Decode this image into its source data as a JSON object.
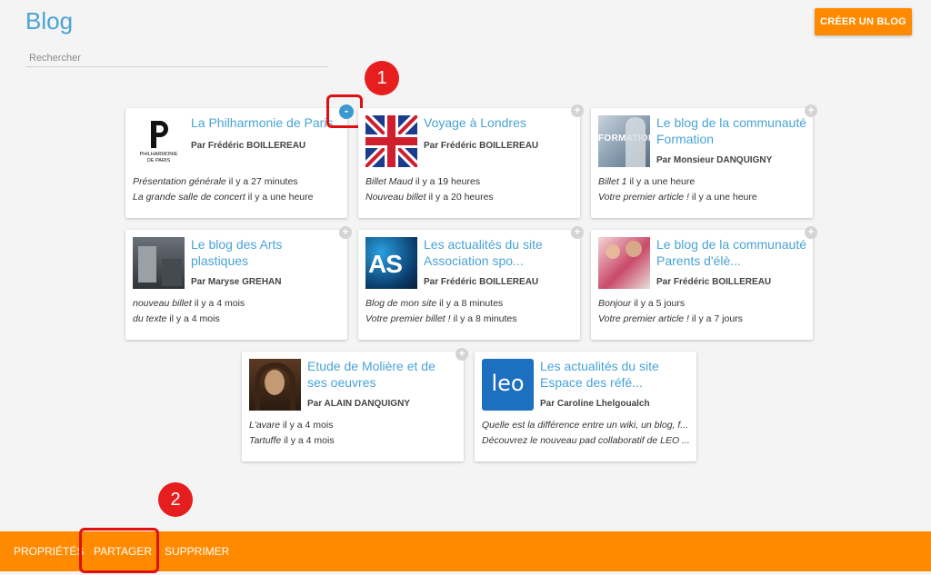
{
  "header": {
    "title": "Blog",
    "create_button": "CRÉER UN BLOG",
    "search_placeholder": "Rechercher"
  },
  "cards": [
    {
      "title": "La Philharmonie de Paris",
      "author": "Par Frédéric BOILLEREAU",
      "thumb_text": [
        "PHILHARMONIE",
        "DE PARIS"
      ],
      "posts": [
        {
          "title": "Présentation générale",
          "time": "il y a 27 minutes"
        },
        {
          "title": "La grande salle de concert",
          "time": "il y a une heure"
        }
      ],
      "selected": true
    },
    {
      "title": "Voyage à Londres",
      "author": "Par Frédéric BOILLEREAU",
      "posts": [
        {
          "title": "Billet Maud",
          "time": "il y a 19 heures"
        },
        {
          "title": "Nouveau billet",
          "time": "il y a 20 heures"
        }
      ]
    },
    {
      "title": "Le blog de la communauté Formation",
      "author": "Par Monsieur DANQUIGNY",
      "thumb_text": [
        "FORMATION"
      ],
      "posts": [
        {
          "title": "Billet 1",
          "time": "il y a une heure"
        },
        {
          "title": "Votre premier article !",
          "time": "il y a une heure"
        }
      ]
    },
    {
      "title": "Le blog des Arts plastiques",
      "author": "Par Maryse GREHAN",
      "posts": [
        {
          "title": "nouveau billet",
          "time": "il y a 4 mois"
        },
        {
          "title": "du texte",
          "time": "il y a 4 mois"
        }
      ]
    },
    {
      "title": "Les actualités du site Association spo...",
      "author": "Par Frédéric BOILLEREAU",
      "thumb_text": [
        "AS"
      ],
      "posts": [
        {
          "title": "Blog de mon site",
          "time": "il y a 8 minutes"
        },
        {
          "title": "Votre premier billet !",
          "time": "il y a 8 minutes"
        }
      ]
    },
    {
      "title": "Le blog de la communauté Parents d'élè...",
      "author": "Par Frédéric BOILLEREAU",
      "posts": [
        {
          "title": "Bonjour",
          "time": "il y a 5 jours"
        },
        {
          "title": "Votre premier article !",
          "time": "il y a 7 jours"
        }
      ]
    },
    {
      "title": "Etude de Molière et de ses oeuvres",
      "author": "Par ALAIN DANQUIGNY",
      "posts": [
        {
          "title": "L'avare",
          "time": "il y a 4 mois"
        },
        {
          "title": "Tartuffe",
          "time": "il y a 4 mois"
        }
      ]
    },
    {
      "title": "Les actualités du site Espace des réfé...",
      "author": "Par Caroline Lhelgoualch",
      "thumb_text": [
        "leo"
      ],
      "posts": [
        {
          "title": "Quelle est la différence entre un wiki, un blog, f...",
          "time": ""
        },
        {
          "title": "Découvrez le nouveau pad collaboratif de LEO ...",
          "time": ""
        }
      ]
    }
  ],
  "controls": {
    "plus": "+",
    "minus": "-"
  },
  "callouts": [
    "1",
    "2"
  ],
  "bottom_bar": {
    "actions": [
      "PROPRIÉTÉS",
      "PARTAGER",
      "SUPPRIMER"
    ]
  },
  "colors": {
    "accent_orange": "#ff8a00",
    "title_blue": "#4aa3d6",
    "highlight_red": "#e01010"
  }
}
